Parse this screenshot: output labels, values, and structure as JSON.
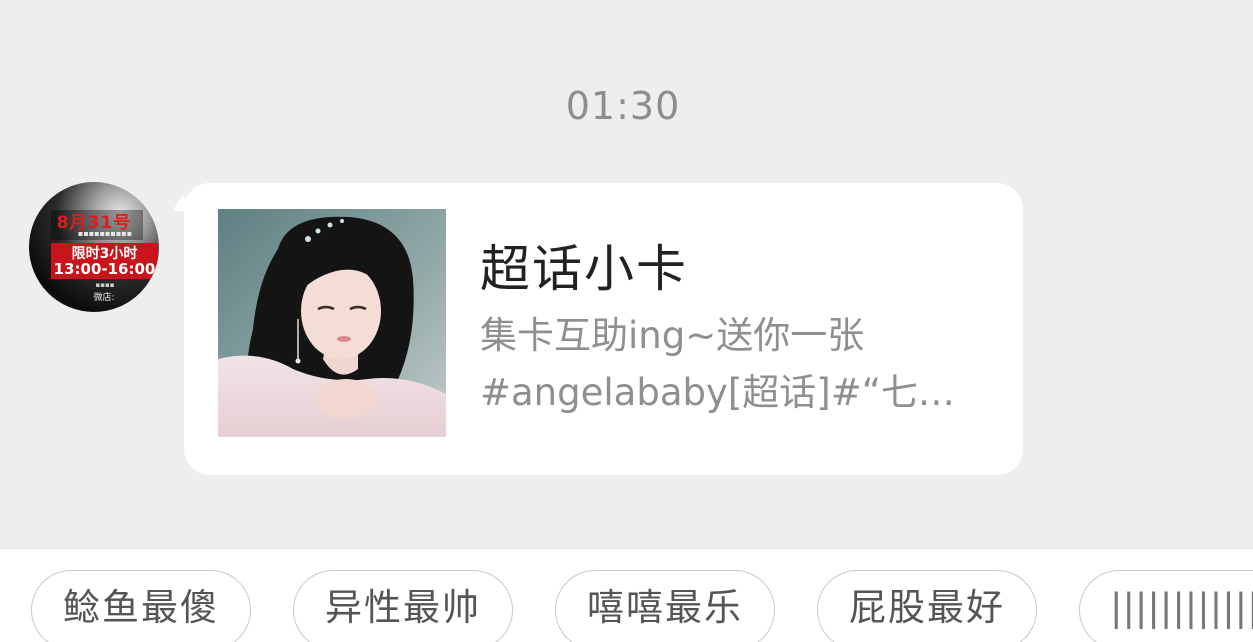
{
  "chat": {
    "timestamp": "01:30",
    "sender_avatar": {
      "icon": "avatar-poster-icon",
      "poster_lines": [
        "8月31号",
        "限时3小时",
        "13:00-16:00",
        "微店:"
      ]
    },
    "message_card": {
      "title": "超话小卡",
      "desc_line1": "集卡互助ing~送你一张",
      "desc_line2": "#angelababy[超话]#“七…",
      "thumbnail_icon": "card-portrait-image"
    }
  },
  "quick_replies": [
    {
      "label": "鲶鱼最傻"
    },
    {
      "label": "异性最帅"
    },
    {
      "label": "嘻嘻最乐"
    },
    {
      "label": "屁股最好"
    },
    {
      "label": "||||||||||||||||"
    }
  ],
  "colors": {
    "background": "#eeeeee",
    "bubble": "#ffffff",
    "title_text": "#222222",
    "secondary_text": "#8f8f8f",
    "chip_border": "#c9c9c9"
  }
}
